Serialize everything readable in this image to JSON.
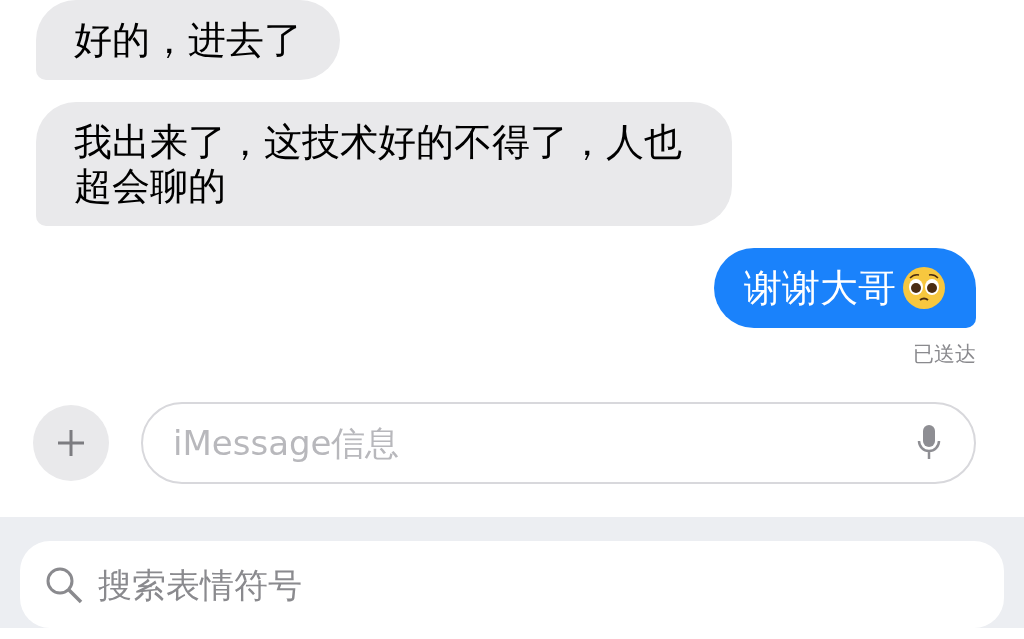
{
  "messages": [
    {
      "sent": false,
      "text": "好的，进去了",
      "emoji": false
    },
    {
      "sent": false,
      "text": "我出来了，这技术好的不得了，人也超会聊的",
      "emoji": false
    },
    {
      "sent": true,
      "text": "谢谢大哥",
      "emoji": true
    }
  ],
  "status": "已送达",
  "compose": {
    "placeholder": "iMessage信息"
  },
  "emoji_search": {
    "placeholder": "搜索表情符号"
  }
}
